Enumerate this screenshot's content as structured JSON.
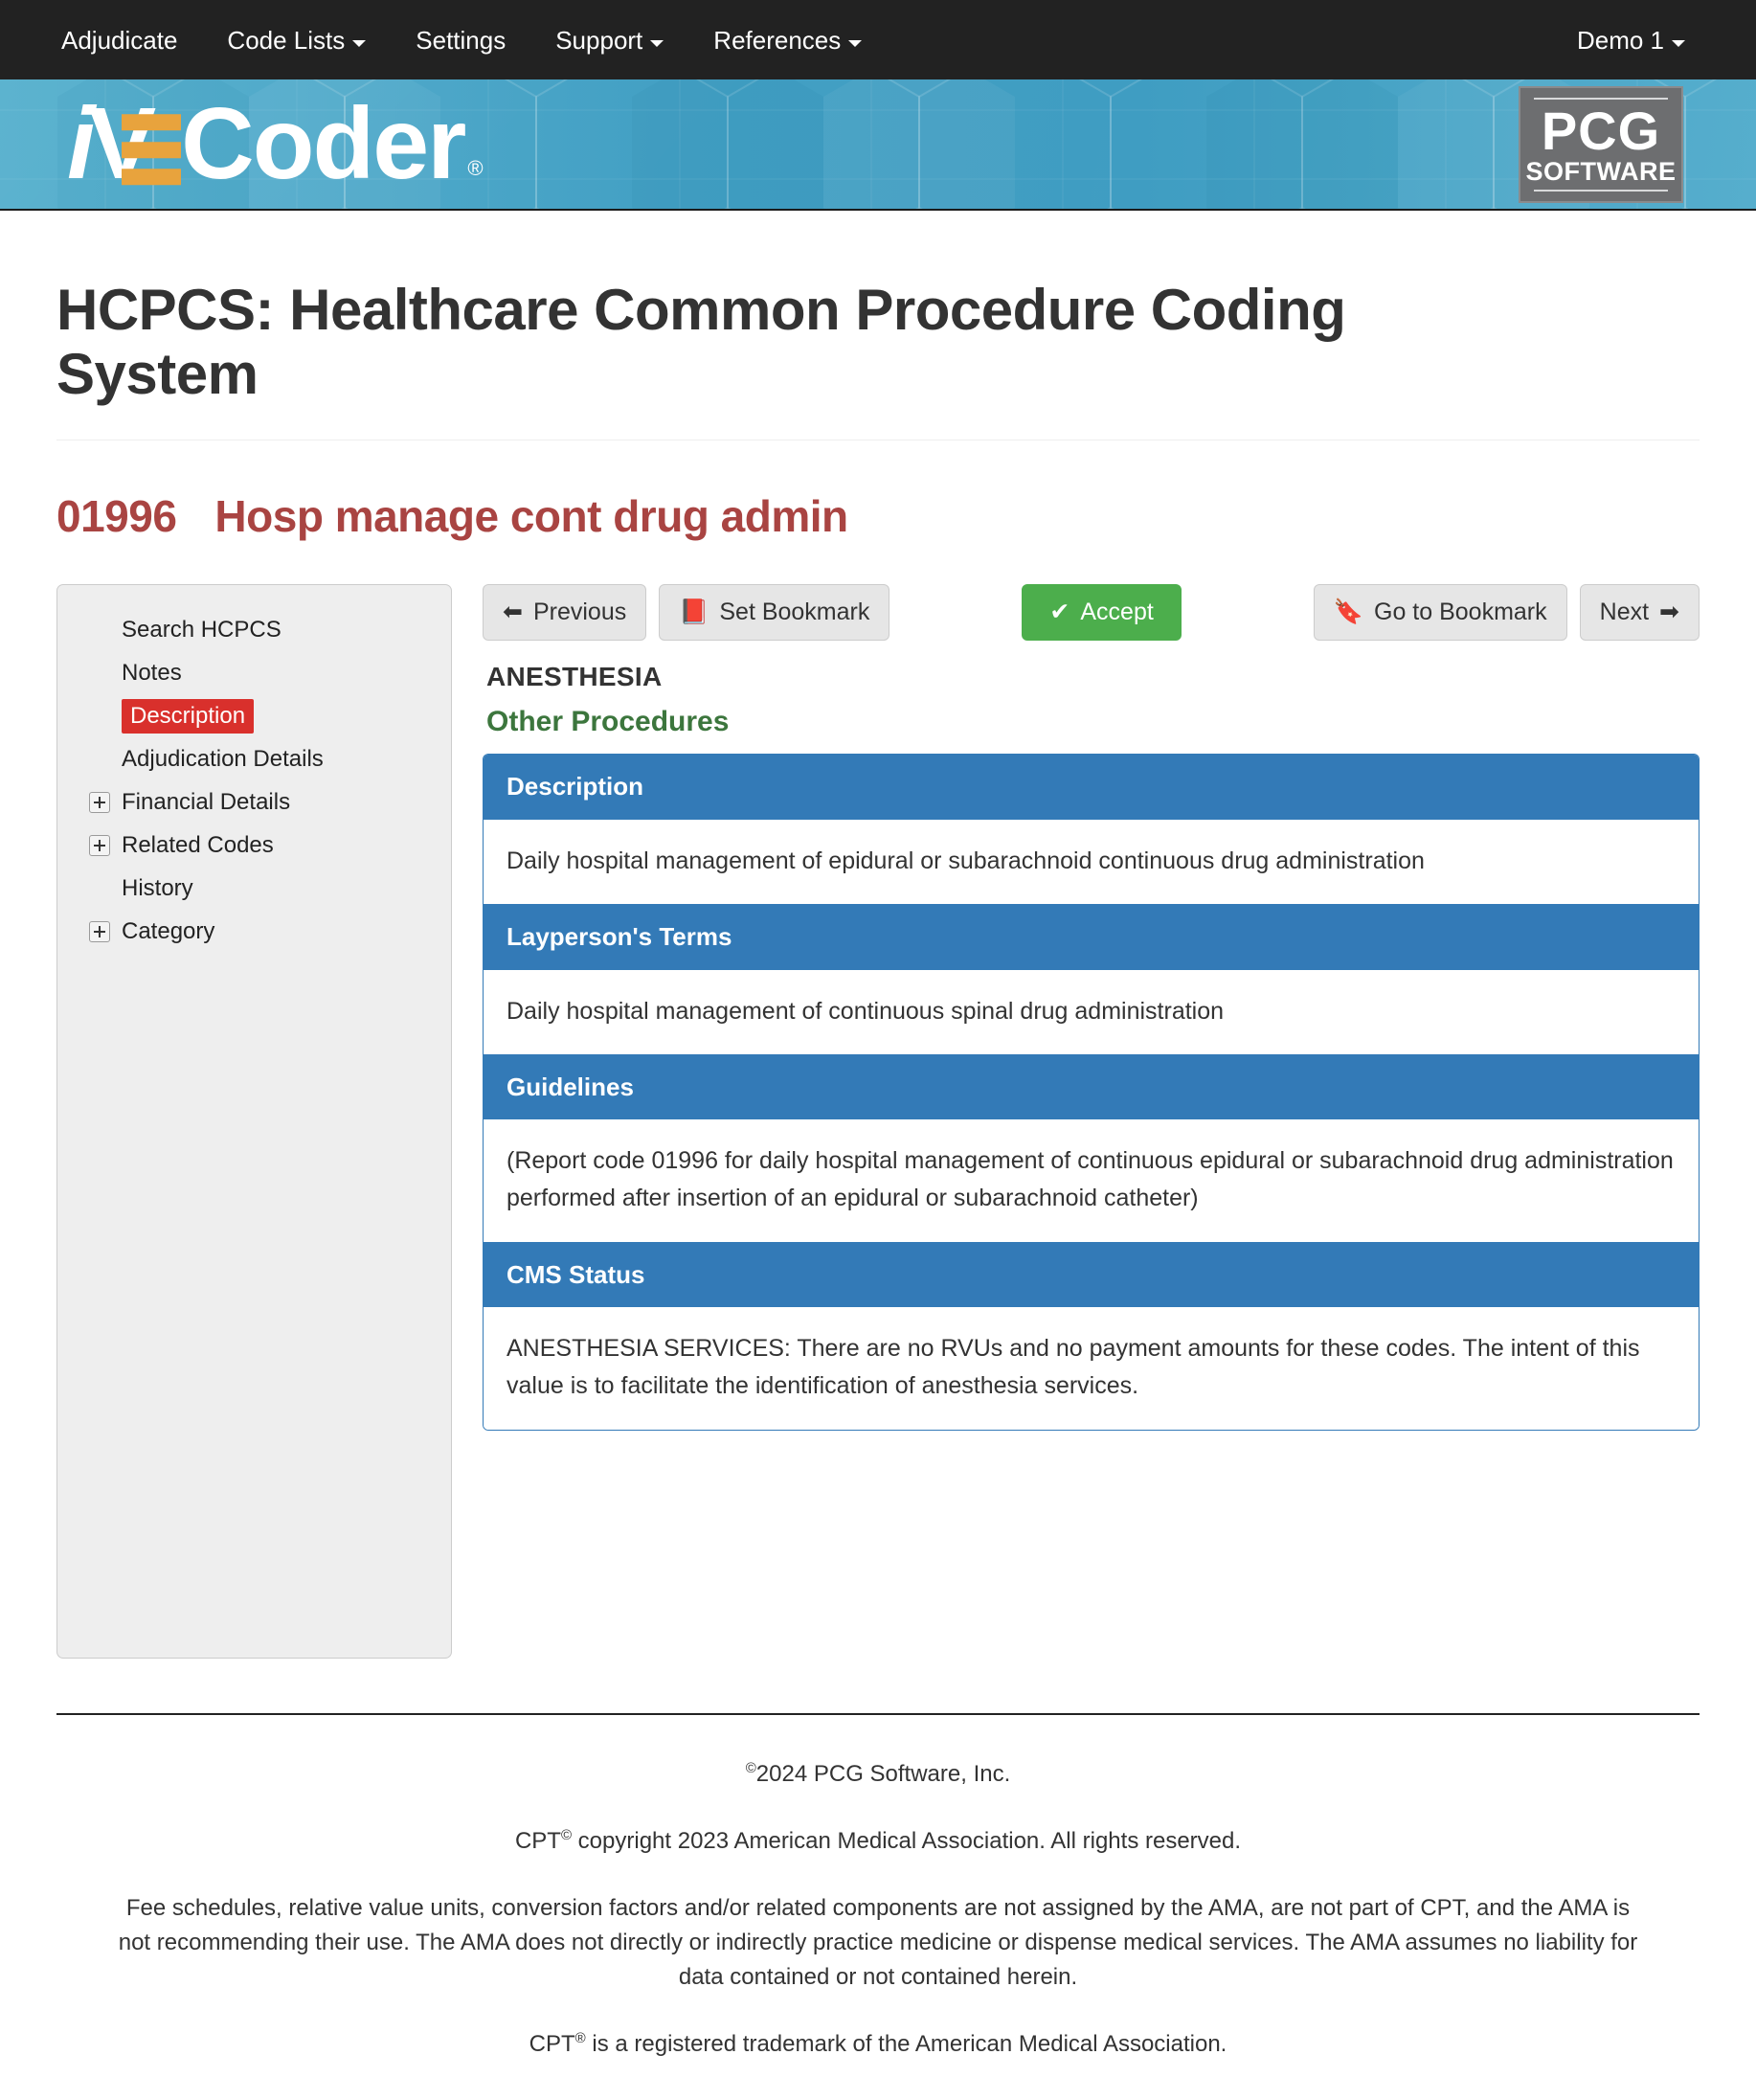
{
  "navbar": {
    "items": [
      {
        "label": "Adjudicate",
        "caret": false
      },
      {
        "label": "Code Lists",
        "caret": true
      },
      {
        "label": "Settings",
        "caret": false
      },
      {
        "label": "Support",
        "caret": true
      },
      {
        "label": "References",
        "caret": true
      }
    ],
    "user": {
      "label": "Demo 1",
      "caret": true
    },
    "background_color": "#222222"
  },
  "banner": {
    "brand": {
      "i": "i",
      "v": "V",
      "e": "E",
      "rest": "Coder",
      "registered": "®"
    },
    "pcg_logo": {
      "main": "PCG",
      "sub": "SOFTWARE"
    },
    "background_color": "#45a1c4",
    "accent_color": "#e8a33d"
  },
  "page": {
    "title": "HCPCS: Healthcare Common Procedure Coding System",
    "code": "01996",
    "code_description": "Hosp manage cont drug admin",
    "code_color": "#a94442"
  },
  "sidebar": {
    "items": [
      {
        "label": "Search HCPCS",
        "expandable": false,
        "active": false
      },
      {
        "label": "Notes",
        "expandable": false,
        "active": false
      },
      {
        "label": "Description",
        "expandable": false,
        "active": true
      },
      {
        "label": "Adjudication Details",
        "expandable": false,
        "active": false
      },
      {
        "label": "Financial Details",
        "expandable": true,
        "active": false
      },
      {
        "label": "Related Codes",
        "expandable": true,
        "active": false
      },
      {
        "label": "History",
        "expandable": false,
        "active": false
      },
      {
        "label": "Category",
        "expandable": true,
        "active": false
      }
    ],
    "active_color": "#d9302c"
  },
  "toolbar": {
    "previous": "Previous",
    "set_bookmark": "Set Bookmark",
    "accept": "Accept",
    "go_to_bookmark": "Go to Bookmark",
    "next": "Next",
    "accept_color": "#4cae4c"
  },
  "main": {
    "section_heading": "ANESTHESIA",
    "section_subheading": "Other Procedures",
    "subheading_color": "#3c763d",
    "panel_color": "#337ab7",
    "panels": [
      {
        "header": "Description",
        "body": "Daily hospital management of epidural or subarachnoid continuous drug administration"
      },
      {
        "header": "Layperson's Terms",
        "body": "Daily hospital management of continuous spinal drug administration"
      },
      {
        "header": "Guidelines",
        "body": "(Report code 01996 for daily hospital management of continuous epidural or subarachnoid drug administration performed after insertion of an epidural or subarachnoid catheter)"
      },
      {
        "header": "CMS Status",
        "body": "ANESTHESIA SERVICES: There are no RVUs and no payment amounts for these codes. The intent of this value is to facilitate the identification of anesthesia services."
      }
    ]
  },
  "footer": {
    "copyright_prefix": "©",
    "copyright": "2024 PCG Software, Inc.",
    "cpt_copyright_pre": "CPT",
    "cpt_copyright_sup": "©",
    "cpt_copyright_post": " copyright 2023 American Medical Association. All rights reserved.",
    "disclaimer": "Fee schedules, relative value units, conversion factors and/or related components are not assigned by the AMA, are not part of CPT, and the AMA is not recommending their use. The AMA does not directly or indirectly practice medicine or dispense medical services. The AMA assumes no liability for data contained or not contained herein.",
    "trademark_pre": "CPT",
    "trademark_sup": "®",
    "trademark_post": " is a registered trademark of the American Medical Association."
  }
}
